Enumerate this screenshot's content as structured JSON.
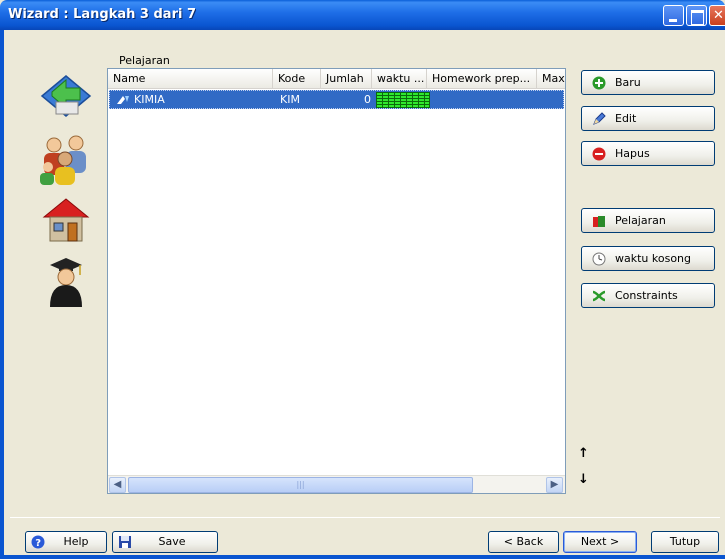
{
  "window": {
    "title": "Wizard : Langkah 3 dari 7"
  },
  "sidebar": {
    "icons": [
      "wizard-arrow-icon",
      "people-group-icon",
      "house-icon",
      "graduate-icon"
    ]
  },
  "grid": {
    "label": "Pelajaran",
    "columns": [
      "Name",
      "Kode",
      "Jumlah",
      "waktu ...",
      "Homework prep...",
      "Max"
    ],
    "rows": [
      {
        "name": "KIMIA",
        "kode": "KIM",
        "jumlah": "0",
        "waktu": "green-grid"
      }
    ]
  },
  "actions": {
    "baru": "Baru",
    "edit": "Edit",
    "hapus": "Hapus",
    "pelajaran": "Pelajaran",
    "waktu_kosong": "waktu kosong",
    "constraints": "Constraints"
  },
  "footer": {
    "help": "Help",
    "save": "Save",
    "back": "< Back",
    "next": "Next >",
    "tutup": "Tutup"
  },
  "colors": {
    "titlebar": "#0a55d0",
    "selection": "#316ac5",
    "dialog_bg": "#ece9d8"
  }
}
